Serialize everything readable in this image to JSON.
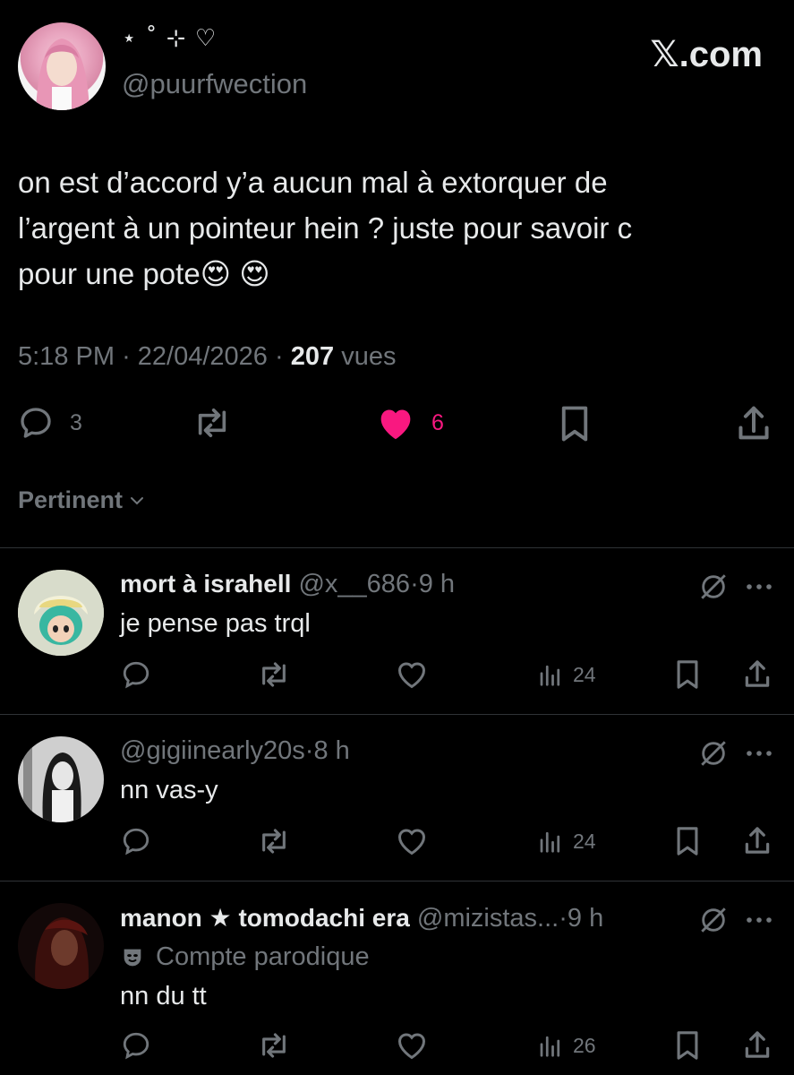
{
  "main": {
    "display_name": "⋆ ˚ ⊹ ♡",
    "handle": "@puurfwection",
    "brand": "𝕏.com",
    "text_line1": "on est d’accord y’a aucun mal à extorquer de",
    "text_line2": "l’argent à un pointeur hein ? juste pour savoir c",
    "text_line3": "pour une pote",
    "emoji": "😍 😍",
    "time": "5:18 PM",
    "date": "22/04/2026",
    "views_count": "207",
    "views_label": "vues",
    "replies": "3",
    "likes": "6"
  },
  "sort": {
    "label": "Pertinent"
  },
  "replies": [
    {
      "name": "mort à israhell",
      "handle": "@x__686",
      "time": "9 h",
      "text": "je pense pas trql",
      "views": "24"
    },
    {
      "name": "",
      "handle": "@gigiinearly20s",
      "time": "8 h",
      "text": "nn vas-y",
      "views": "24"
    },
    {
      "name": "manon ★ tomodachi era",
      "handle": "@mizistas...",
      "time": "9 h",
      "badge": "Compte parodique",
      "text": "nn du tt",
      "views": "26"
    }
  ],
  "colors": {
    "background": "#000000",
    "text": "#e7e9ea",
    "muted": "#71767b",
    "like": "#f91880",
    "divider": "#2f3336"
  }
}
